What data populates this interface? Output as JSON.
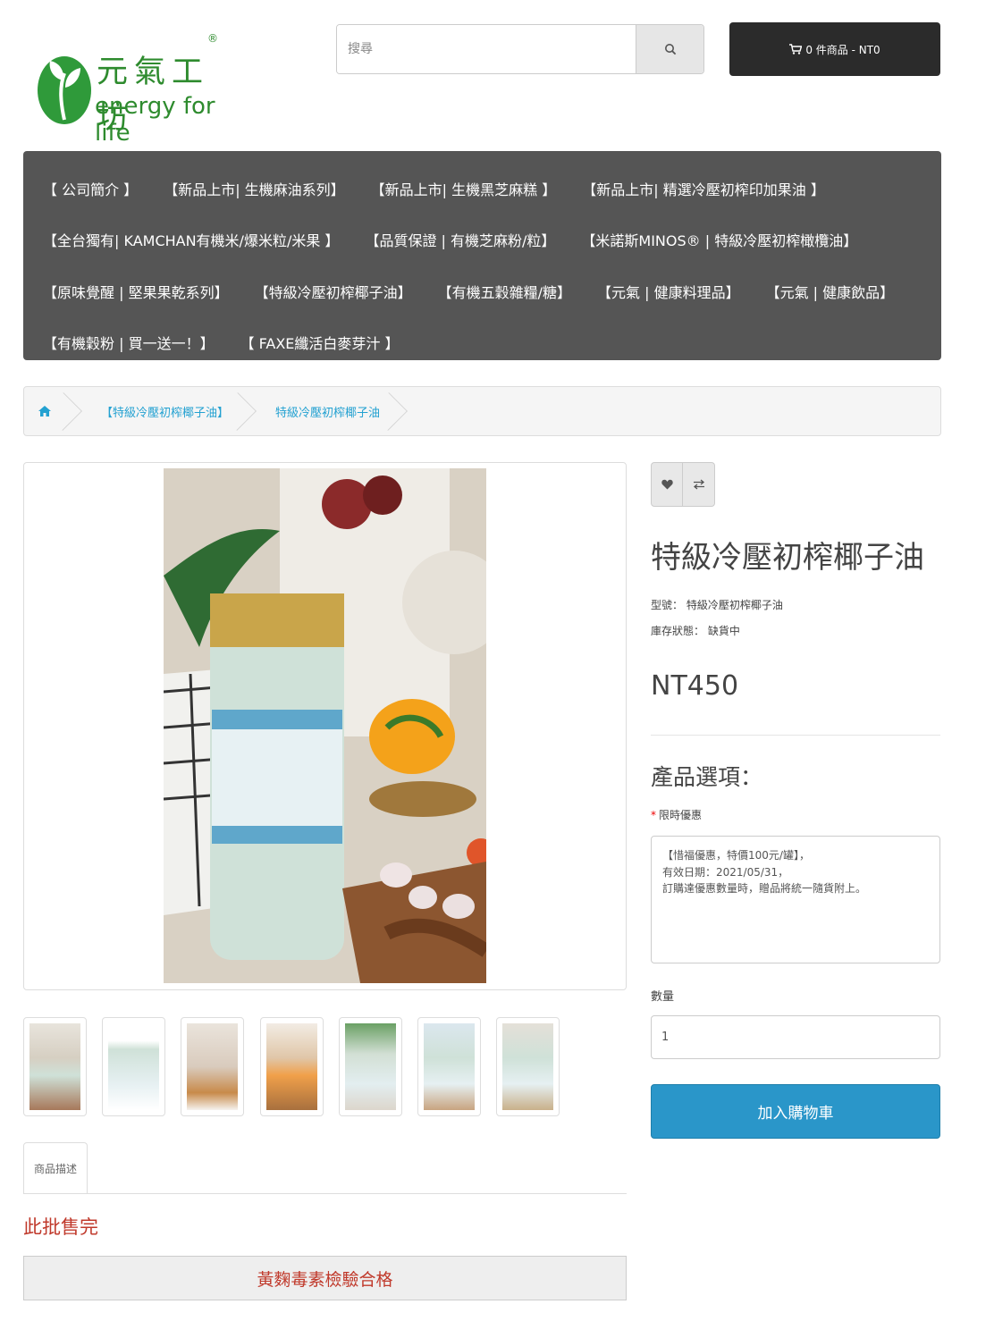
{
  "brand": {
    "name_cn": "元氣工坊",
    "tagline": "energy for life",
    "registered_mark": "®"
  },
  "search": {
    "placeholder": "搜尋",
    "button_icon": "search-icon"
  },
  "cart": {
    "icon": "shopping-cart-icon",
    "label": "0 件商品 - NT0"
  },
  "menu": {
    "rows": [
      [
        "【 公司簡介 】",
        "【新品上市| 生機麻油系列】",
        "【新品上市| 生機黑芝麻糕 】",
        "【新品上市| 精選冷壓初榨印加果油 】"
      ],
      [
        "【全台獨有| KAMCHAN有機米/爆米粒/米果 】",
        "【品質保證 | 有機芝麻粉/粒】",
        "【米諾斯MINOS® | 特級冷壓初榨橄欖油】"
      ],
      [
        "【原味覺醒 | 堅果果乾系列】",
        "【特級冷壓初榨椰子油】",
        "【有機五穀雜糧/糖】",
        "【元氣 | 健康料理品】",
        "【元氣 | 健康飲品】"
      ],
      [
        "【有機穀粉 | 買一送一！】",
        "【 FAXE纖活白麥芽汁 】"
      ]
    ]
  },
  "breadcrumb": {
    "home_icon": "home-icon",
    "category": "【特級冷壓初榨椰子油】",
    "current": "特級冷壓初榨椰子油"
  },
  "product": {
    "title": "特級冷壓初榨椰子油",
    "model_label": "型號：",
    "model_value": "特級冷壓初榨椰子油",
    "stock_label": "庫存狀態：",
    "stock_value": "缺貨中",
    "price": "NT450",
    "wishlist_icon": "heart-icon",
    "compare_icon": "exchange-icon",
    "thumbnail_count": 7
  },
  "options": {
    "title": "產品選項：",
    "field_label": "限時優惠",
    "field_value": "【惜福優惠，特價100元/罐】，\n有效日期：2021/05/31，\n訂購達優惠數量時，贈品將統一隨貨附上。",
    "qty_label": "數量",
    "qty_value": "1",
    "add_to_cart_label": "加入購物車"
  },
  "tabs": {
    "description_label": "商品描述"
  },
  "description": {
    "sold_out": "此批售完",
    "aflatoxin": "黃麴毒素檢驗合格"
  },
  "colors": {
    "menu_bg": "#555555",
    "cart_bg": "#2b2b2b",
    "link": "#23a1d1",
    "button_primary": "#2a96c9",
    "alert_red": "#c0392b",
    "brand_green": "#2e8b2e"
  }
}
